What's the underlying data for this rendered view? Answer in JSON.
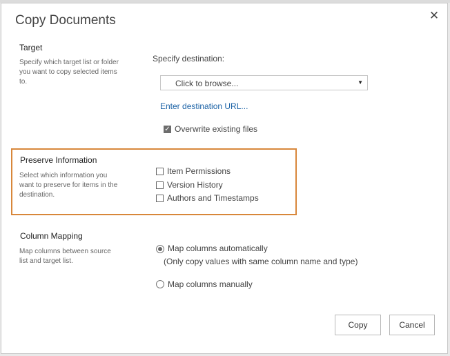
{
  "dialog": {
    "title": "Copy Documents",
    "close_icon": "close-icon"
  },
  "target": {
    "title": "Target",
    "description_lines": [
      "Specify which target list or folder",
      "you want to copy selected items",
      "to."
    ],
    "destination_label": "Specify destination:",
    "browse_value": "Click to browse...",
    "dropdown_icon": "dropdown-arrow-icon",
    "destination_url_link": "Enter destination URL...",
    "overwrite_label": "Overwrite existing files",
    "overwrite_checked": true
  },
  "preserve": {
    "title": "Preserve Information",
    "description_lines": [
      "Select which information you",
      "want to preserve for items in the",
      "destination."
    ],
    "options": [
      {
        "label": "Item Permissions",
        "checked": false
      },
      {
        "label": "Version History",
        "checked": false
      },
      {
        "label": "Authors and Timestamps",
        "checked": false
      }
    ],
    "highlight_color": "#d8873a"
  },
  "mapping": {
    "title": "Column Mapping",
    "description_lines": [
      "Map columns between source",
      "list and target list."
    ],
    "auto_label": "Map columns automatically",
    "auto_note": "(Only copy values with same column name and type)",
    "manual_label": "Map columns manually",
    "selected": "auto"
  },
  "buttons": {
    "copy_label": "Copy",
    "cancel_label": "Cancel"
  }
}
